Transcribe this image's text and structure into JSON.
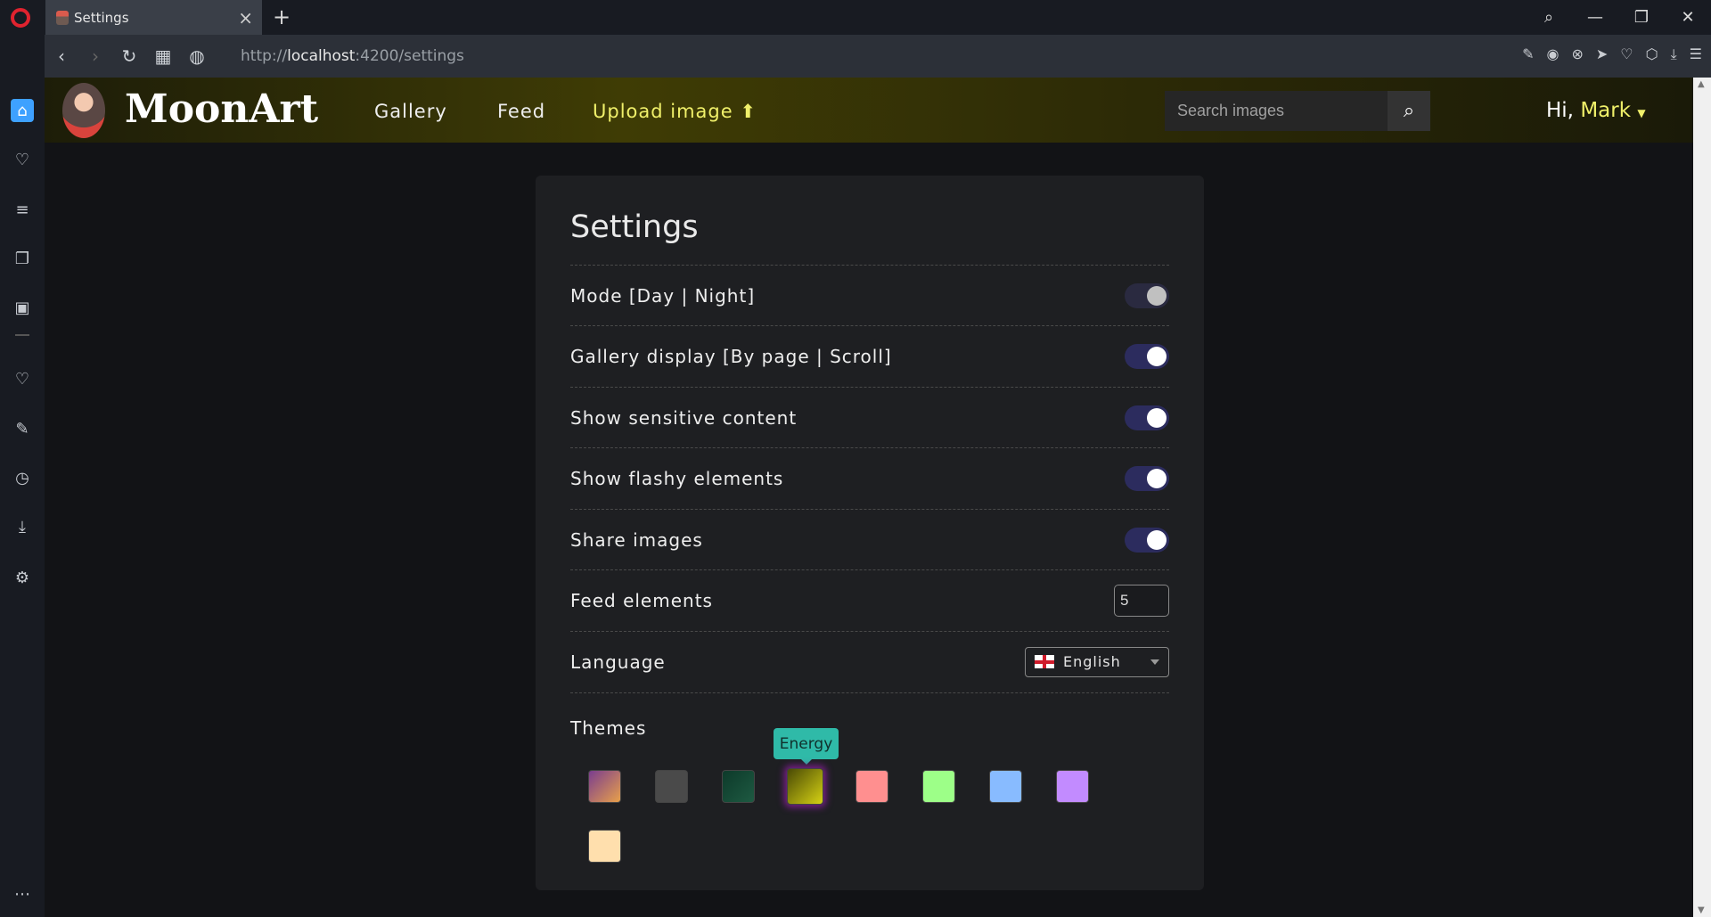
{
  "browser": {
    "tab_title": "Settings",
    "new_tab": "+",
    "url_prefix": "http://",
    "url_host": "localhost",
    "url_rest": ":4200/settings"
  },
  "header": {
    "brand": "MoonArt",
    "nav": [
      "Gallery",
      "Feed",
      "Upload image"
    ],
    "search_placeholder": "Search images",
    "greeting": "Hi,",
    "user": "Mark"
  },
  "settings": {
    "title": "Settings",
    "rows": [
      {
        "label": "Mode [Day | Night]",
        "control": "toggle",
        "on": false
      },
      {
        "label": "Gallery display [By page | Scroll]",
        "control": "toggle",
        "on": true
      },
      {
        "label": "Show sensitive content",
        "control": "toggle",
        "on": true
      },
      {
        "label": "Show flashy elements",
        "control": "toggle",
        "on": true
      },
      {
        "label": "Share images",
        "control": "toggle",
        "on": true
      },
      {
        "label": "Feed elements",
        "control": "number",
        "value": "5"
      },
      {
        "label": "Language",
        "control": "select",
        "value": "English"
      }
    ],
    "themes_label": "Themes",
    "tooltip": "Energy",
    "themes": [
      {
        "color": "#c96a70"
      },
      {
        "color": "#4a4a4a"
      },
      {
        "color": "#124233"
      },
      {
        "color": "#7a7708",
        "selected": true
      },
      {
        "color": "#ff8f8f"
      },
      {
        "color": "#9dff88"
      },
      {
        "color": "#88bbff"
      },
      {
        "color": "#c28bff"
      },
      {
        "color": "#ffdfad"
      }
    ]
  },
  "colors": {
    "accent": "#f0f06a",
    "toggle_on": "#2c2c5e"
  }
}
